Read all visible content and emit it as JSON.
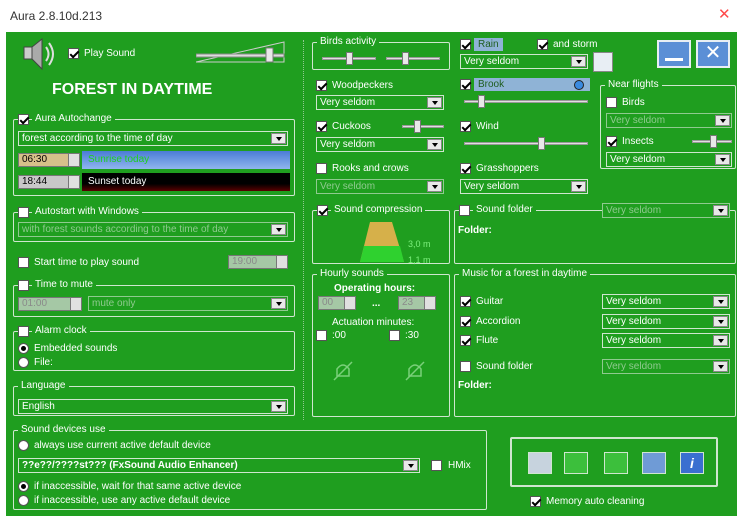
{
  "window": {
    "title": "Aura 2.8.10d.213",
    "close_icon": "close-icon"
  },
  "sound": {
    "play_label": "Play Sound",
    "scene_title": "FOREST IN DAYTIME"
  },
  "autochange": {
    "label": "Aura Autochange",
    "mode": "forest according to the time of day",
    "sunrise_time": "06:30",
    "sunrise_label": "Sunrise today",
    "sunset_time": "18:44",
    "sunset_label": "Sunset today"
  },
  "autostart": {
    "label": "Autostart with Windows",
    "option": "with forest sounds according to the time of day"
  },
  "start_time": {
    "label": "Start time to play sound",
    "value": "19:00"
  },
  "mute": {
    "label": "Time to mute",
    "time": "01:00",
    "option": "mute only"
  },
  "alarm": {
    "label": "Alarm clock",
    "embedded": "Embedded sounds",
    "file": "File:"
  },
  "language": {
    "label": "Language",
    "value": "English"
  },
  "devices": {
    "label": "Sound devices use",
    "opt1": "always use current active default device",
    "device": "??e??/????st??? (FxSound Audio Enhancer)",
    "hmix": "HMix",
    "opt2": "if inaccessible, wait for that same active device",
    "opt3": "if inaccessible, use any active default device"
  },
  "birds": {
    "label": "Birds activity"
  },
  "woodpeckers": {
    "label": "Woodpeckers",
    "value": "Very seldom"
  },
  "cuckoos": {
    "label": "Cuckoos",
    "value": "Very seldom"
  },
  "rooks": {
    "label": "Rooks and crows",
    "value": "Very seldom"
  },
  "compression": {
    "label": "Sound compression",
    "high": "3,0 m",
    "low": "1,1 m"
  },
  "hourly": {
    "label": "Hourly sounds",
    "op_hours": "Operating hours:",
    "from": "00",
    "dots": "...",
    "to": "23",
    "act_minutes": "Actuation minutes:",
    "m00": ":00",
    "m30": ":30"
  },
  "rain": {
    "label": "Rain",
    "storm": "and storm",
    "value": "Very seldom"
  },
  "brook": {
    "label": "Brook"
  },
  "wind": {
    "label": "Wind"
  },
  "grasshoppers": {
    "label": "Grasshoppers",
    "value": "Very seldom"
  },
  "folder": {
    "label": "Sound folder",
    "value": "Very seldom",
    "folder_label": "Folder:"
  },
  "near": {
    "label": "Near flights",
    "birds": "Birds",
    "birds_value": "Very seldom",
    "insects": "Insects",
    "insects_value": "Very seldom"
  },
  "music": {
    "label": "Music for a forest in daytime",
    "guitar": "Guitar",
    "guitar_value": "Very seldom",
    "accordion": "Accordion",
    "accordion_value": "Very seldom",
    "flute": "Flute",
    "flute_value": "Very seldom",
    "folder": "Sound folder",
    "folder_value": "Very seldom",
    "folder_label": "Folder:"
  },
  "memory": {
    "label": "Memory auto cleaning"
  }
}
